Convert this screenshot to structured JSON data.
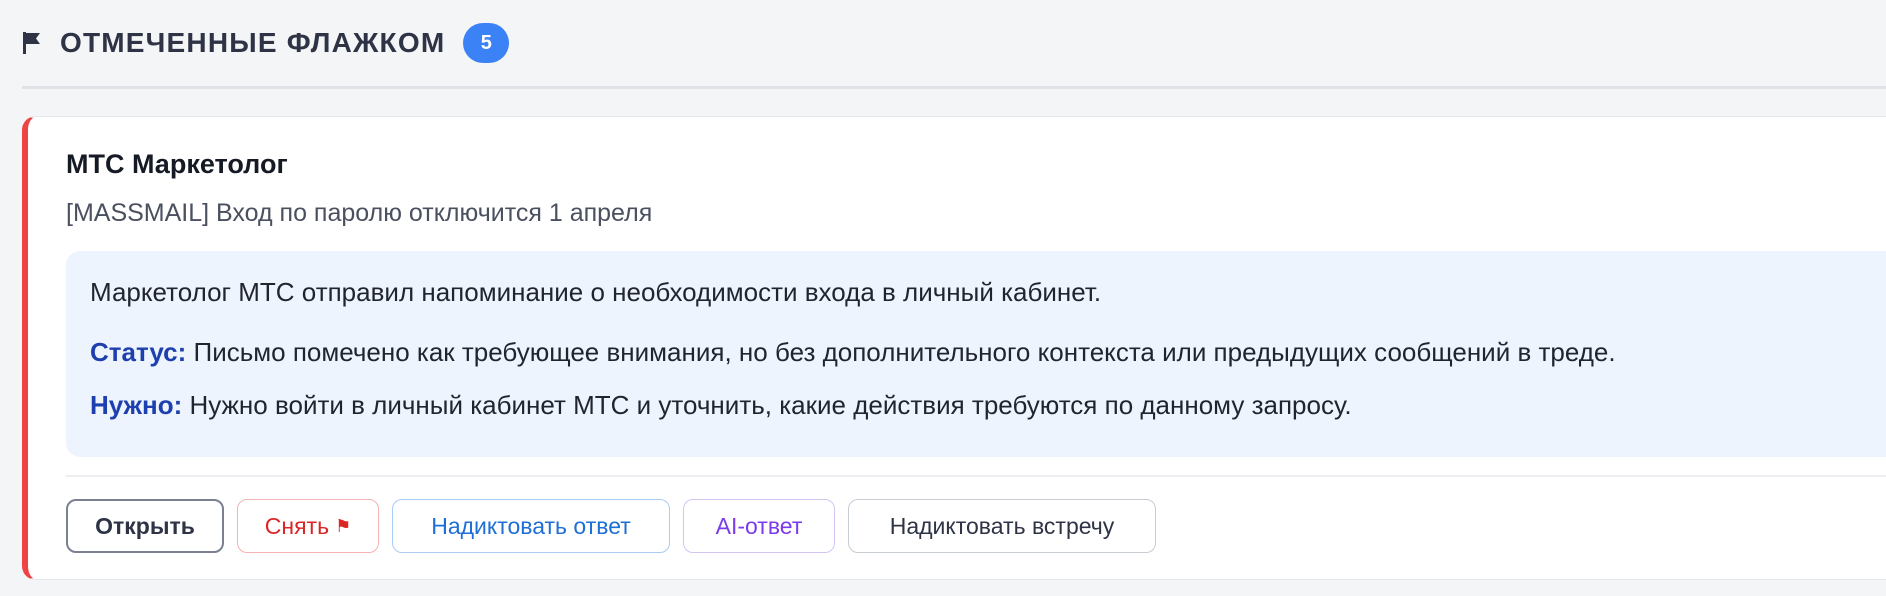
{
  "section": {
    "title": "ОТМЕЧЕННЫЕ ФЛАЖКОМ",
    "icon": "flag-icon",
    "count": "5"
  },
  "card": {
    "accent_color": "#ef4444",
    "sender": "МТС Маркетолог",
    "subject": "[MASSMAIL] Вход по паролю отключится 1 апреля",
    "summary": "Маркетолог МТС отправил напоминание о необходимости входа в личный кабинет.",
    "status_label": "Статус:",
    "status_text": " Письмо помечено как требующее внимания, но без дополнительного контекста или предыдущих сообщений в треде.",
    "need_label": "Нужно:",
    "need_text": " Нужно войти в личный кабинет МТС и уточнить, какие действия требуются по данному запросу."
  },
  "actions": {
    "open": "Открыть",
    "unflag": "Снять",
    "unflag_icon": "⚑",
    "dictate_reply": "Надиктовать ответ",
    "ai_reply": "AI-ответ",
    "dictate_meeting": "Надиктовать встречу"
  },
  "colors": {
    "badge": "#3b82f6",
    "label": "#1e40af",
    "summary_bg": "#eef4fd"
  }
}
